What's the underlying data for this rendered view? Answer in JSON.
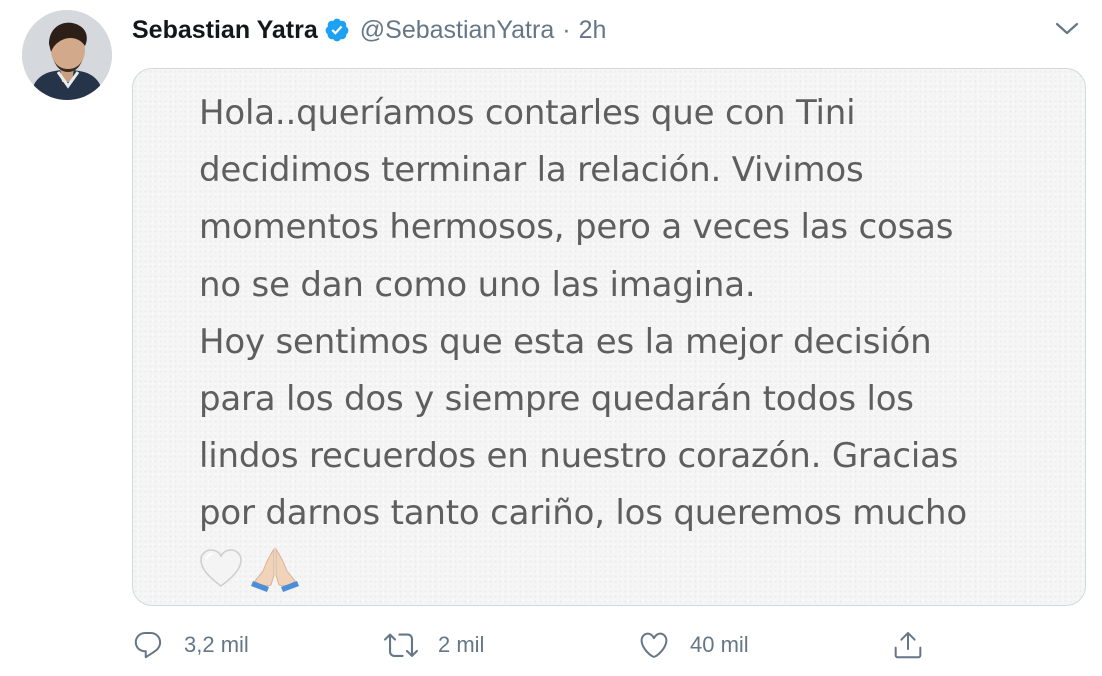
{
  "tweet": {
    "display_name": "Sebastian Yatra",
    "handle": "@SebastianYatra",
    "separator": "·",
    "time": "2h",
    "verified": true,
    "accent_color": "#1da1f2",
    "avatar_icon": "profile-photo",
    "menu_icon": "chevron-down-icon"
  },
  "media": {
    "lines": [
      "Hola..queríamos contarles que con Tini",
      "decidimos terminar la relación. Vivimos",
      "momentos hermosos, pero a veces las cosas",
      "no se dan como uno las imagina.",
      "Hoy sentimos que esta es la mejor decisión",
      "para los dos y siempre quedarán todos los",
      "lindos recuerdos en nuestro corazón. Gracias",
      "por darnos tanto cariño, los queremos mucho"
    ],
    "emojis": [
      "white-heart-emoji",
      "folded-hands-emoji"
    ]
  },
  "actions": {
    "reply": {
      "icon": "reply-icon",
      "count": "3,2 mil"
    },
    "retweet": {
      "icon": "retweet-icon",
      "count": "2 mil"
    },
    "like": {
      "icon": "heart-icon",
      "count": "40 mil"
    },
    "share": {
      "icon": "share-icon"
    }
  }
}
